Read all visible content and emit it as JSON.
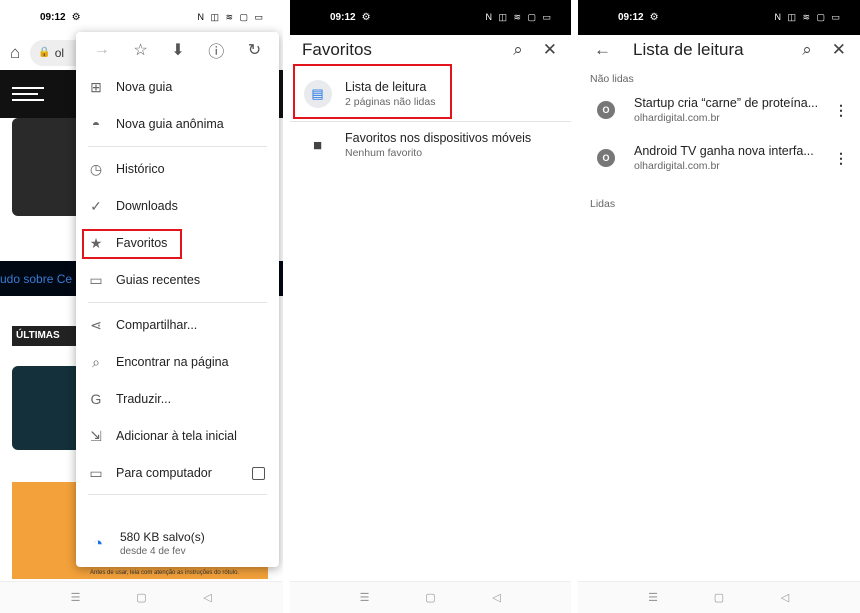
{
  "status": {
    "time": "09:12"
  },
  "screen1": {
    "omni_text": "ol",
    "promo_text": "udo sobre Ce",
    "ultimas_text": "ÚLTIMAS",
    "ad_text": "Antes de usar, leia com atenção as instruções do rótulo.",
    "menu_items": [
      {
        "label": "Nova guia",
        "icon": "plus-square-icon"
      },
      {
        "label": "Nova guia anônima",
        "icon": "incognito-icon"
      },
      {
        "label": "Histórico",
        "icon": "history-icon"
      },
      {
        "label": "Downloads",
        "icon": "download-done-icon"
      },
      {
        "label": "Favoritos",
        "icon": "star-icon"
      },
      {
        "label": "Guias recentes",
        "icon": "devices-icon"
      },
      {
        "label": "Compartilhar...",
        "icon": "share-icon"
      },
      {
        "label": "Encontrar na página",
        "icon": "find-in-page-icon"
      },
      {
        "label": "Traduzir...",
        "icon": "translate-icon"
      },
      {
        "label": "Adicionar à tela inicial",
        "icon": "add-to-home-icon"
      },
      {
        "label": "Para computador",
        "icon": "desktop-icon"
      }
    ],
    "saved_title": "580 KB salvo(s)",
    "saved_sub": "desde 4 de fev"
  },
  "screen2": {
    "title": "Favoritos",
    "items": [
      {
        "title": "Lista de leitura",
        "sub": "2 páginas não lidas"
      },
      {
        "title": "Favoritos nos dispositivos móveis",
        "sub": "Nenhum favorito"
      }
    ]
  },
  "screen3": {
    "title": "Lista de leitura",
    "unread_label": "Não lidas",
    "read_label": "Lidas",
    "items": [
      {
        "title": "Startup cria “carne” de proteína...",
        "sub": "olhardigital.com.br",
        "favicon": "O"
      },
      {
        "title": "Android TV ganha nova interfa...",
        "sub": "olhardigital.com.br",
        "favicon": "O"
      }
    ]
  },
  "colors": {
    "highlight": "#e3141b",
    "accent": "#1a73e8"
  }
}
